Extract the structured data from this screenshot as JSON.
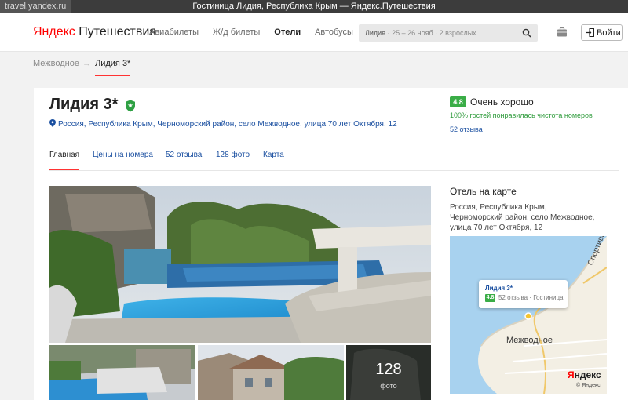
{
  "browser": {
    "url": "travel.yandex.ru",
    "window_title": "Гостиница Лидия, Республика Крым — Яндекс.Путешествия"
  },
  "header": {
    "logo_prefix": "Яндекс",
    "logo_suffix": " Путешествия",
    "nav": [
      "Авиабилеты",
      "Ж/д билеты",
      "Отели",
      "Автобусы"
    ],
    "nav_active": "Отели",
    "search": {
      "place": "Лидия",
      "details": " · 25 – 26 нояб · 2 взрослых"
    },
    "login_label": "Войти"
  },
  "breadcrumb": {
    "parent": "Межводное",
    "separator": "→",
    "current": "Лидия 3*"
  },
  "hotel": {
    "name": "Лидия 3*",
    "address": "Россия, Республика Крым, Черноморский район, село Межводное, улица 70 лет Октября, 12",
    "rating": "4.8",
    "rating_label": "Очень хорошо",
    "cleanliness": "100% гостей понравилась чистота номеров",
    "reviews_link": "52 отзыва"
  },
  "tabs": [
    "Главная",
    "Цены на номера",
    "52 отзыва",
    "128 фото",
    "Карта"
  ],
  "photos": {
    "count": "128",
    "count_label": "фото"
  },
  "map": {
    "title": "Отель на карте",
    "address": "Россия, Республика Крым, Черноморский район, село Межводное, улица 70 лет Октября, 12",
    "popup_name": "Лидия 3*",
    "popup_rating": "4.8",
    "popup_details": "52 отзыва · Гостиница",
    "town_label": "Межводное",
    "road_label": "Спортивн",
    "logo_prefix": "Я",
    "logo_suffix": "ндекс",
    "copyright": "© Яндекс"
  },
  "colors": {
    "accent_red": "#ff3333",
    "link_blue": "#1a4fa0",
    "rating_green": "#3aad47",
    "clean_green": "#2e9b3b"
  }
}
